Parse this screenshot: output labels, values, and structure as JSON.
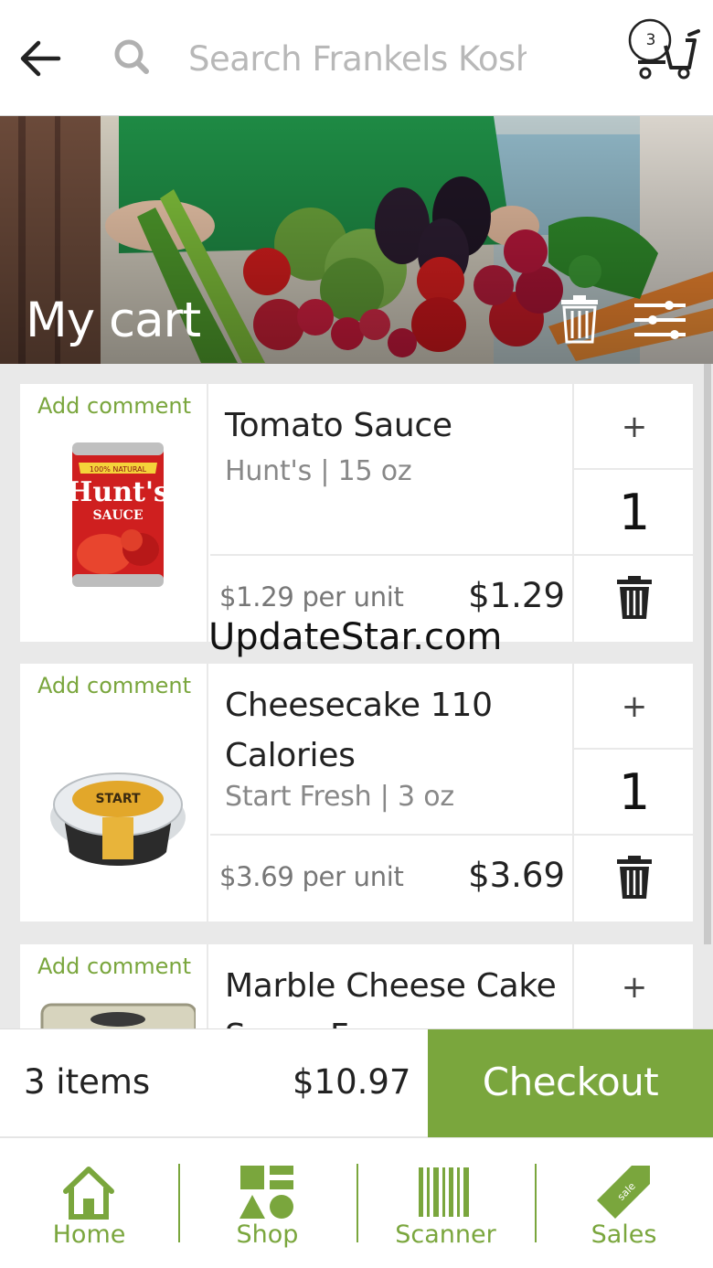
{
  "header": {
    "search_placeholder": "Search Frankels Kosh",
    "cart_count": "3"
  },
  "banner": {
    "title": "My cart"
  },
  "cart_items": [
    {
      "add_comment": "Add comment",
      "name": "Tomato Sauce",
      "subtitle": "Hunt's | 15 oz",
      "unit_price": "$1.29 per unit",
      "total": "$1.29",
      "plus": "+",
      "quantity": "1",
      "image_label": "Hunt's SAUCE"
    },
    {
      "add_comment": "Add comment",
      "name": "Cheesecake 110 Calories",
      "subtitle": "Start Fresh | 3 oz",
      "unit_price": "$3.69 per unit",
      "total": "$3.69",
      "plus": "+",
      "quantity": "1"
    },
    {
      "add_comment": "Add comment",
      "name": "Marble Cheese Cake Sugar Free",
      "plus": "+"
    }
  ],
  "watermark": "UpdateStar.com",
  "checkout": {
    "items_label": "3 items",
    "total": "$10.97",
    "button_label": "Checkout"
  },
  "bottom_nav": [
    {
      "label": "Home",
      "icon": "home-icon"
    },
    {
      "label": "Shop",
      "icon": "shapes-icon"
    },
    {
      "label": "Scanner",
      "icon": "barcode-icon"
    },
    {
      "label": "Sales",
      "icon": "sale-tag-icon",
      "tag_text": "sale"
    }
  ],
  "colors": {
    "accent": "#7aa63d",
    "list_bg": "#e9e9e9"
  }
}
